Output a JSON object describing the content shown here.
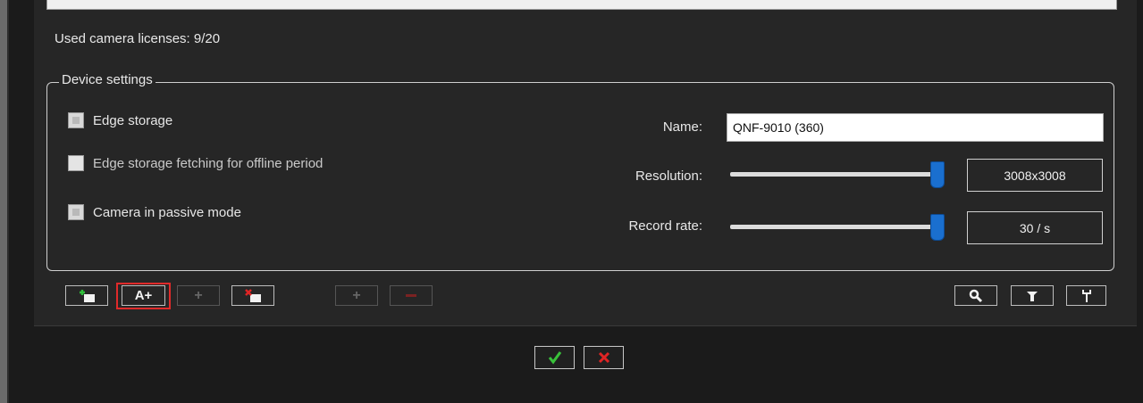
{
  "licenses": {
    "text": "Used camera licenses: 9/20"
  },
  "device_settings": {
    "title": "Device settings",
    "checkboxes": [
      {
        "label": "Edge storage",
        "checked": true,
        "enabled": true
      },
      {
        "label": "Edge storage fetching for offline period",
        "checked": false,
        "enabled": false
      },
      {
        "label": "Camera in passive mode",
        "checked": true,
        "enabled": true
      }
    ],
    "name": {
      "label": "Name:",
      "value": "QNF-9010 (360)"
    },
    "resolution": {
      "label": "Resolution:",
      "value": "3008x3008",
      "slider_level": 1.0
    },
    "record_rate": {
      "label": "Record rate:",
      "value": "30 / s",
      "slider_level": 1.0
    }
  },
  "toolbar": {
    "add_camera_icon": "add-device-icon",
    "add_auto_label": "A+",
    "add_disabled_icon": "plus-icon",
    "remove_camera_icon": "remove-device-icon",
    "add_group_icon": "plus-icon",
    "remove_group_icon": "minus-icon",
    "search_icon": "search-icon",
    "filter_icon": "filter-icon",
    "tools_icon": "wrench-icon"
  },
  "dialog": {
    "ok_icon": "check-icon",
    "cancel_icon": "x-icon"
  },
  "colors": {
    "accent": "#1a6fcf",
    "highlight": "#e02a2a",
    "ok": "#39c23a",
    "cancel": "#e02424"
  }
}
